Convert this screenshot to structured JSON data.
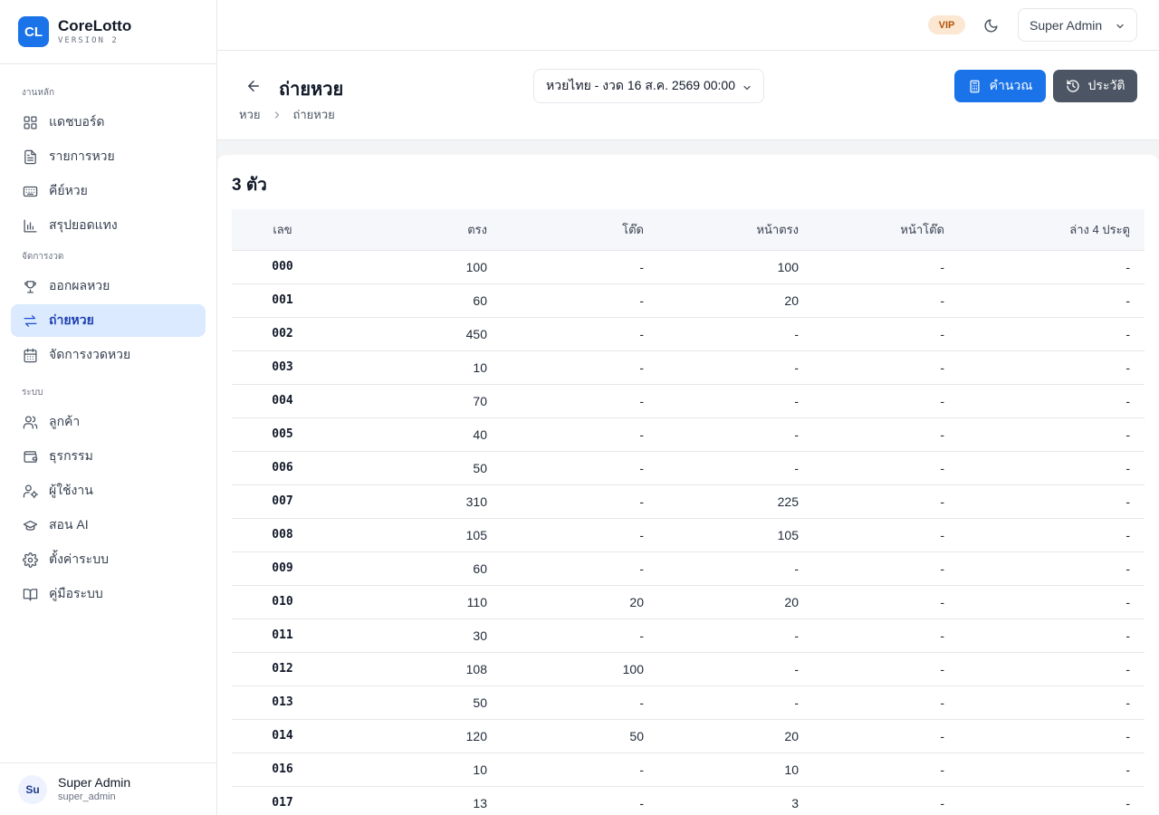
{
  "app": {
    "logo": "CL",
    "name": "CoreLotto",
    "version": "VERSION 2"
  },
  "sidebar": {
    "sections": [
      {
        "label": "งานหลัก",
        "items": [
          {
            "label": "แดชบอร์ด",
            "icon": "dashboard-icon"
          },
          {
            "label": "รายการหวย",
            "icon": "document-icon"
          },
          {
            "label": "คีย์หวย",
            "icon": "keyboard-icon"
          },
          {
            "label": "สรุปยอดแทง",
            "icon": "bar-chart-icon"
          }
        ]
      },
      {
        "label": "จัดการงวด",
        "items": [
          {
            "label": "ออกผลหวย",
            "icon": "trophy-icon"
          },
          {
            "label": "ถ่ายหวย",
            "icon": "transfer-icon",
            "active": true
          },
          {
            "label": "จัดการงวดหวย",
            "icon": "calendar-icon"
          }
        ]
      },
      {
        "label": "ระบบ",
        "items": [
          {
            "label": "ลูกค้า",
            "icon": "users-icon"
          },
          {
            "label": "ธุรกรรม",
            "icon": "wallet-icon"
          },
          {
            "label": "ผู้ใช้งาน",
            "icon": "user-cog-icon"
          },
          {
            "label": "สอน AI",
            "icon": "graduation-cap-icon"
          },
          {
            "label": "ตั้งค่าระบบ",
            "icon": "settings-icon"
          },
          {
            "label": "คู่มือระบบ",
            "icon": "book-icon"
          }
        ]
      }
    ]
  },
  "footer_user": {
    "initials": "Su",
    "name": "Super Admin",
    "username": "super_admin"
  },
  "topbar": {
    "badge": "VIP",
    "user_menu": "Super Admin"
  },
  "page": {
    "title": "ถ่ายหวย",
    "breadcrumb": [
      "หวย",
      "ถ่ายหวย"
    ],
    "draw_select": "หวยไทย - งวด 16 ส.ค. 2569 00:00",
    "calc_button": "คำนวณ",
    "history_button": "ประวัติ"
  },
  "table": {
    "title": "3 ตัว",
    "columns": [
      "เลข",
      "ตรง",
      "โต๊ด",
      "หน้าตรง",
      "หน้าโต๊ด",
      "ล่าง 4 ประตู"
    ],
    "rows": [
      [
        "000",
        "100",
        "-",
        "100",
        "-",
        "-"
      ],
      [
        "001",
        "60",
        "-",
        "20",
        "-",
        "-"
      ],
      [
        "002",
        "450",
        "-",
        "-",
        "-",
        "-"
      ],
      [
        "003",
        "10",
        "-",
        "-",
        "-",
        "-"
      ],
      [
        "004",
        "70",
        "-",
        "-",
        "-",
        "-"
      ],
      [
        "005",
        "40",
        "-",
        "-",
        "-",
        "-"
      ],
      [
        "006",
        "50",
        "-",
        "-",
        "-",
        "-"
      ],
      [
        "007",
        "310",
        "-",
        "225",
        "-",
        "-"
      ],
      [
        "008",
        "105",
        "-",
        "105",
        "-",
        "-"
      ],
      [
        "009",
        "60",
        "-",
        "-",
        "-",
        "-"
      ],
      [
        "010",
        "110",
        "20",
        "20",
        "-",
        "-"
      ],
      [
        "011",
        "30",
        "-",
        "-",
        "-",
        "-"
      ],
      [
        "012",
        "108",
        "100",
        "-",
        "-",
        "-"
      ],
      [
        "013",
        "50",
        "-",
        "-",
        "-",
        "-"
      ],
      [
        "014",
        "120",
        "50",
        "20",
        "-",
        "-"
      ],
      [
        "016",
        "10",
        "-",
        "10",
        "-",
        "-"
      ],
      [
        "017",
        "13",
        "-",
        "3",
        "-",
        "-"
      ]
    ]
  }
}
